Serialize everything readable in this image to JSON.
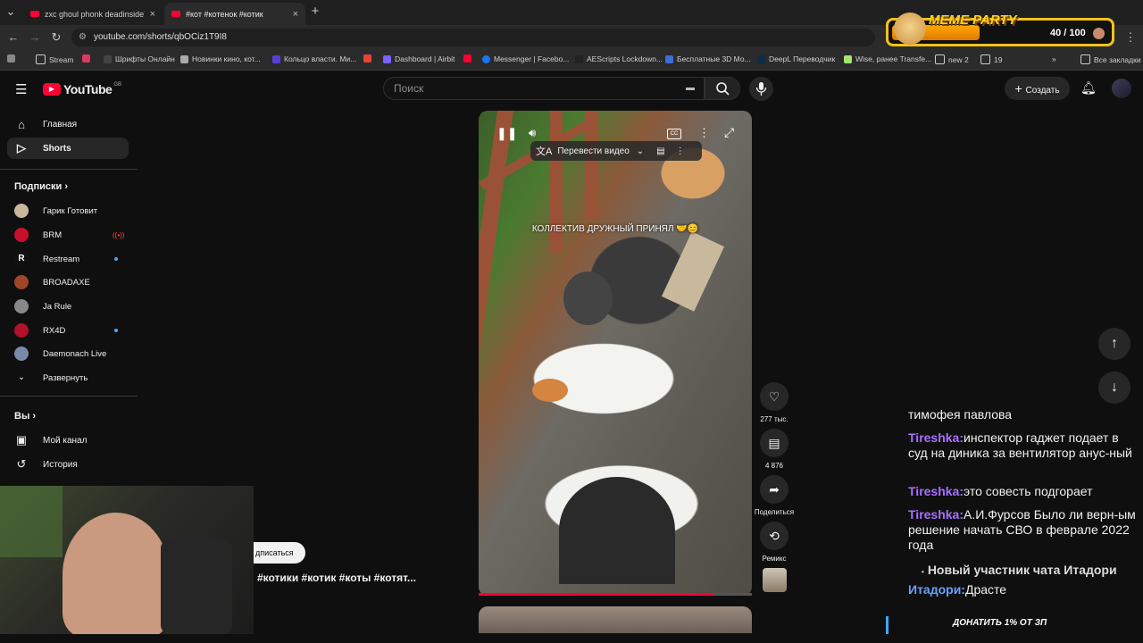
{
  "browser": {
    "tabs": [
      {
        "title": "zxc ghoul phonk deadinside7) ©"
      },
      {
        "title": "#кот #котенок #котик"
      }
    ],
    "url": "youtube.com/shorts/qbOCiz1T9I8",
    "bookmarks": [
      "Stream",
      "Шрифты Онлайн",
      "Новинки кино, кот...",
      "Кольцо власти. Ми...",
      "Dashboard | Airbit",
      "Messenger | Facebo...",
      "AEScripts Lockdown...",
      "Бесплатные 3D Мо...",
      "DeepL Переводчик",
      "Wise, ранее Transfe...",
      "new 2",
      "19",
      "Все закладки"
    ]
  },
  "header": {
    "logo": "YouTube",
    "logo_region": "GB",
    "search_placeholder": "Поиск",
    "create_label": "Создать"
  },
  "sidebar": {
    "main": [
      {
        "label": "Главная",
        "icon": "home-icon"
      },
      {
        "label": "Shorts",
        "icon": "shorts-icon"
      }
    ],
    "subscriptions_title": "Подписки",
    "subscriptions": [
      {
        "label": "Гарик Готовит",
        "color": "#c9b79c"
      },
      {
        "label": "BRM",
        "color": "#c8102e"
      },
      {
        "label": "Restream",
        "color": "#111111"
      },
      {
        "label": "BROADAXE",
        "color": "#a0442a"
      },
      {
        "label": "Ja Rule",
        "color": "#888888"
      },
      {
        "label": "RX4D",
        "color": "#b0122a"
      },
      {
        "label": "Daemonach Live",
        "color": "#7a8aa8"
      }
    ],
    "expand_label": "Развернуть",
    "you_title": "Вы",
    "you": [
      {
        "label": "Мой канал",
        "icon": "channel-icon"
      },
      {
        "label": "История",
        "icon": "history-icon"
      }
    ]
  },
  "video": {
    "translate_label": "Перевести видео",
    "caption": "КОЛЛЕКТИВ ДРУЖНЫЙ ПРИНЯЛ 🤝😊",
    "progress": 0.86,
    "subscribe_label": "дписаться",
    "hashtags": "#котики #котик #коты #котят..."
  },
  "actions": [
    {
      "name": "like",
      "icon": "heart-icon",
      "glyph": "♡",
      "label": "277 тыс."
    },
    {
      "name": "comments",
      "icon": "comment-icon",
      "glyph": "▤",
      "label": "4 876"
    },
    {
      "name": "share",
      "icon": "share-icon",
      "glyph": "➦",
      "label": "Поделиться"
    },
    {
      "name": "remix",
      "icon": "remix-icon",
      "glyph": "⟲",
      "label": "Ремикс"
    }
  ],
  "overlay": {
    "meme_title": "MEME PARTY",
    "meme_count": "40 / 100",
    "meme_progress": 0.4,
    "donate_text": "ДОНАТИТЬ 1% ОТ ЗП"
  },
  "chat": [
    {
      "nick": "",
      "text": "тимофея павлова"
    },
    {
      "nick": "Tireshka:",
      "text": "инспектор гаджет подает в суд на диника за вентилятор анус-ный"
    },
    {
      "nick": "Tireshka:",
      "text": "это совесть подгорает"
    },
    {
      "nick": "Tireshka:",
      "text": "А.И.Фурсов Было ли верн-ым решение начать СВО в феврале 2022 года"
    },
    {
      "nick": "",
      "text": "Новый участник чата Итадори"
    },
    {
      "nick": "Итадори:",
      "text": "Драсте"
    }
  ]
}
